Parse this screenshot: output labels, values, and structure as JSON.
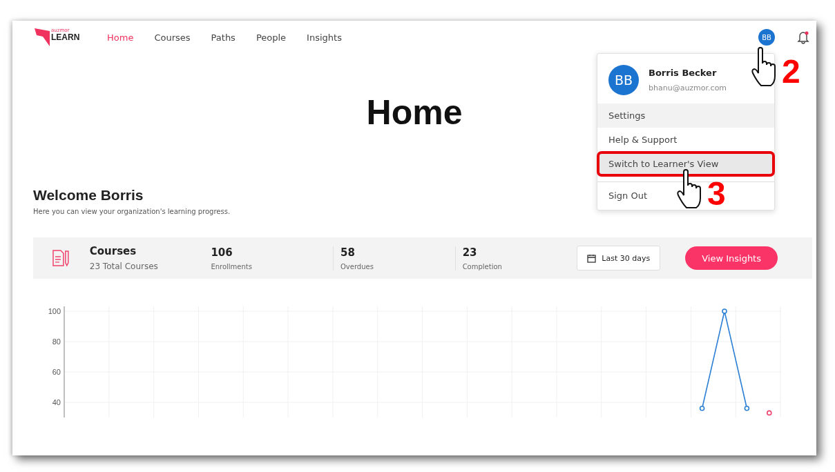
{
  "nav": {
    "logo_small": "auzmor",
    "logo": "LEARN",
    "items": [
      {
        "label": "Home",
        "selected": true
      },
      {
        "label": "Courses",
        "selected": false
      },
      {
        "label": "Paths",
        "selected": false
      },
      {
        "label": "People",
        "selected": false
      },
      {
        "label": "Insights",
        "selected": false
      }
    ],
    "avatar": "BB",
    "notification_dot": true
  },
  "page_title": "Home",
  "welcome": {
    "title": "Welcome Borris",
    "subtitle": "Here you can view your organization's learning progress."
  },
  "stats": {
    "title": "Courses",
    "subtitle": "23 Total Courses",
    "items": [
      {
        "value": "106",
        "label": "Enrollments"
      },
      {
        "value": "58",
        "label": "Overdues"
      },
      {
        "value": "23",
        "label": "Completion"
      }
    ],
    "date_button": "Last 30 days",
    "action_button": "View Insights"
  },
  "chart_data": {
    "type": "line",
    "grid": true,
    "ylim": [
      30,
      100
    ],
    "yticks": [
      40,
      60,
      80,
      100
    ],
    "series": [
      {
        "color": "#2a7fd4",
        "marker": true,
        "values": [
          null,
          null,
          null,
          null,
          null,
          null,
          null,
          null,
          null,
          null,
          null,
          null,
          null,
          null,
          null,
          null,
          null,
          null,
          null,
          null,
          null,
          null,
          null,
          null,
          null,
          null,
          null,
          null,
          36,
          100,
          36,
          null
        ]
      },
      {
        "color": "#f0426e",
        "marker": true,
        "values": [
          null,
          null,
          null,
          null,
          null,
          null,
          null,
          null,
          null,
          null,
          null,
          null,
          null,
          null,
          null,
          null,
          null,
          null,
          null,
          null,
          null,
          null,
          null,
          null,
          null,
          null,
          null,
          null,
          null,
          null,
          null,
          33
        ]
      }
    ]
  },
  "user_menu": {
    "avatar": "BB",
    "name": "Borris Becker",
    "email": "bhanu@auzmor.com",
    "items": [
      {
        "label": "Settings",
        "hovered": true,
        "highlighted": false
      },
      {
        "label": "Help & Support",
        "hovered": false,
        "highlighted": false
      },
      {
        "label": "Switch to Learner's View",
        "hovered": true,
        "highlighted": true
      },
      {
        "label": "Sign Out",
        "hovered": false,
        "highlighted": false
      }
    ]
  },
  "annotations": [
    {
      "label": "2"
    },
    {
      "label": "3"
    }
  ]
}
